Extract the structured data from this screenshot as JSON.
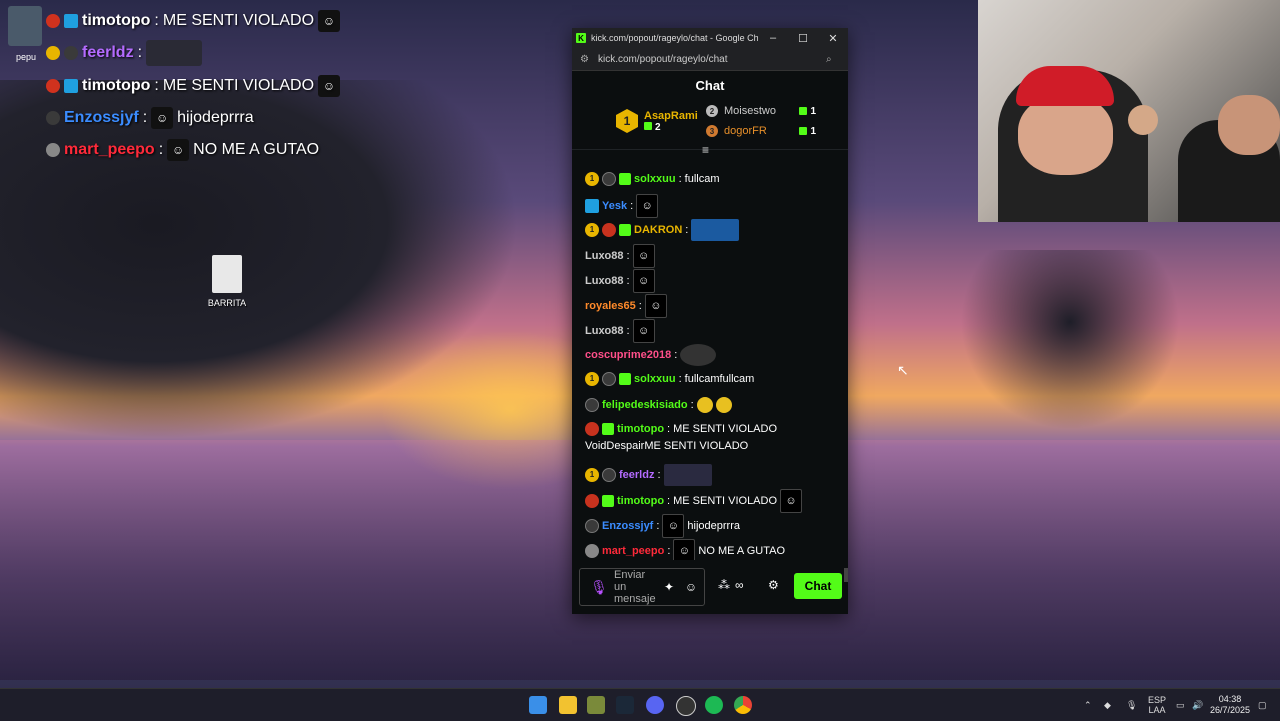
{
  "overlay": {
    "avatar_name": "pepu",
    "lines": [
      {
        "user": "timotopo",
        "text": "ME SENTI VIOLADO",
        "color": "#ffffff"
      },
      {
        "user": "feerldz",
        "text": "",
        "color": "#b46bff"
      },
      {
        "user": "timotopo",
        "text": "ME SENTI VIOLADO",
        "color": "#ffffff"
      },
      {
        "user": "Enzossjyf",
        "text": "hijodeprrra",
        "color": "#3b8cff"
      },
      {
        "user": "mart_peepo",
        "text": "NO ME A GUTAO",
        "color": "#ff2a3a"
      }
    ]
  },
  "desktop": {
    "file_label": "BARRITA"
  },
  "browser": {
    "window_title": "kick.com/popout/rageylo/chat - Google Chro...",
    "url": "kick.com/popout/rageylo/chat",
    "minimize": "–",
    "maximize": "☐",
    "close": "✕"
  },
  "chat": {
    "header": "Chat",
    "leaderboard": {
      "first": {
        "rank": "1",
        "name": "AsapRami",
        "count": "2"
      },
      "others": [
        {
          "rank": "2",
          "name": "Moisestwo",
          "count": "1"
        },
        {
          "rank": "3",
          "name": "dogorFR",
          "count": "1"
        }
      ]
    },
    "messages": [
      {
        "user": "solxxuu",
        "text": "fullcam",
        "user_color": "#53fc18"
      },
      {
        "user": "Yesk",
        "text": "",
        "user_color": "#3b8cff"
      },
      {
        "user": "DAKRON",
        "text": "",
        "user_color": "#e8b500"
      },
      {
        "user": "Luxo88",
        "text": "",
        "user_color": "#cccccc"
      },
      {
        "user": "Luxo88",
        "text": "",
        "user_color": "#cccccc"
      },
      {
        "user": "royales65",
        "text": "",
        "user_color": "#ff8a2a"
      },
      {
        "user": "Luxo88",
        "text": "",
        "user_color": "#cccccc"
      },
      {
        "user": "coscuprime2018",
        "text": "",
        "user_color": "#ff4f8a"
      },
      {
        "user": "solxxuu",
        "text": "fullcamfullcam",
        "user_color": "#53fc18"
      },
      {
        "user": "felipedeskisiado",
        "text": "",
        "user_color": "#53fc18"
      },
      {
        "user": "timotopo",
        "text": "ME SENTI VIOLADO",
        "line2": "VoidDespairME SENTI VIOLADO",
        "user_color": "#53fc18"
      },
      {
        "user": "feerldz",
        "text": "",
        "user_color": "#b46bff"
      },
      {
        "user": "timotopo",
        "text": "ME SENTI VIOLADO",
        "user_color": "#53fc18"
      },
      {
        "user": "Enzossjyf",
        "text": "hijodeprrra",
        "user_color": "#3b8cff"
      },
      {
        "user": "mart_peepo",
        "text": "NO ME A GUTAO",
        "user_color": "#ff2a3a"
      }
    ],
    "input_placeholder": "Enviar un mensaje",
    "send_label": "Chat",
    "sub_badge": "1"
  },
  "taskbar": {
    "lang_line1": "ESP",
    "lang_line2": "LAA",
    "time": "04:38",
    "date": "26/7/2025"
  },
  "colors": {
    "kick_green": "#53fc18",
    "gold": "#e8b500",
    "purple": "#b46bff",
    "blue": "#3b8cff",
    "red": "#ff2a3a"
  }
}
